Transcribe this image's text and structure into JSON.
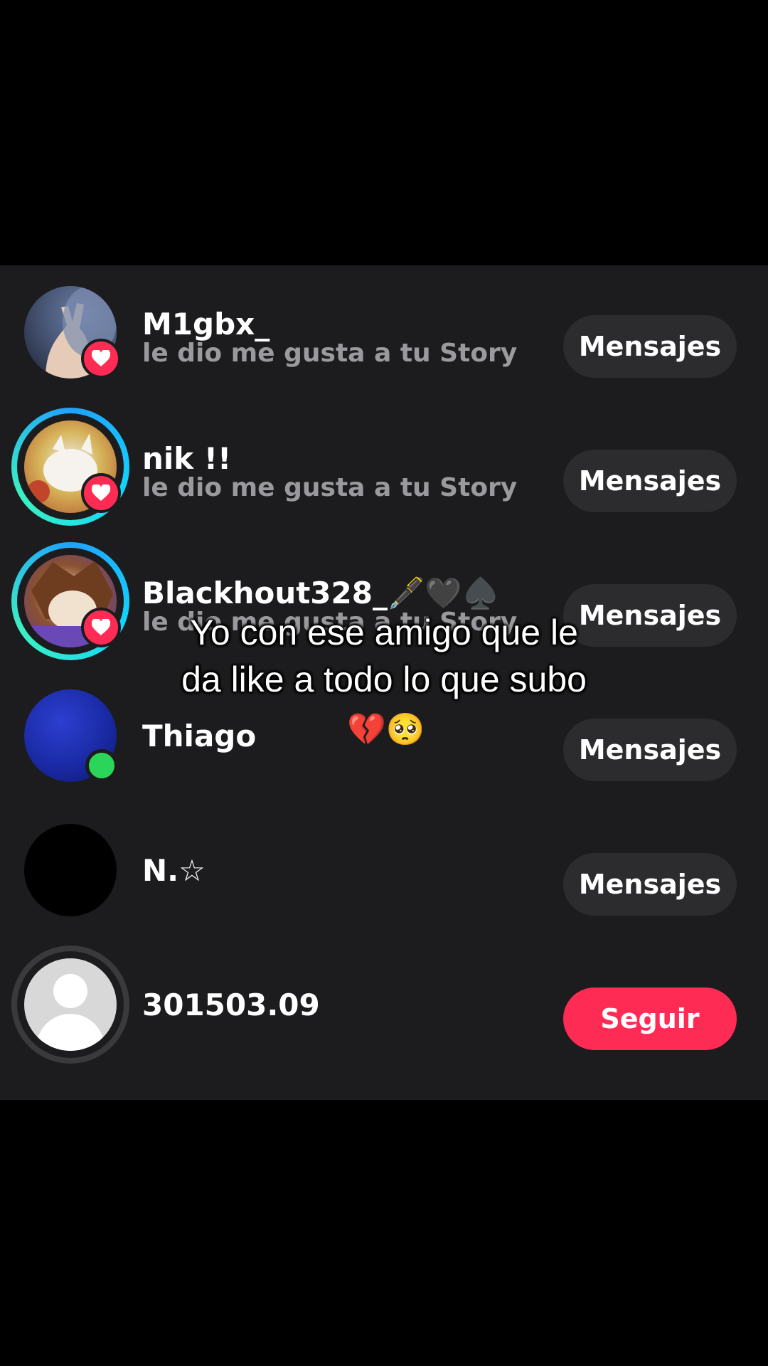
{
  "colors": {
    "panel_bg": "#1c1c1e",
    "button_bg": "#2c2c2e",
    "follow_bg": "#fe2c55",
    "like_badge": "#fe2c55",
    "online": "#2bd55a",
    "subtext": "#9a9a9e"
  },
  "rows": [
    {
      "name": "M1gbx_",
      "subtitle": "le dio me gusta a tu Story",
      "button": "Mensajes",
      "badge": "heart-icon"
    },
    {
      "name": "nik !!",
      "subtitle": "le dio me gusta a tu Story",
      "button": "Mensajes",
      "badge": "heart-icon",
      "ring": "story"
    },
    {
      "name": "Blackhout328_🖋️🖤♠️",
      "subtitle": "le dio me gusta a tu Story",
      "button": "Mensajes",
      "badge": "heart-icon",
      "ring": "story"
    },
    {
      "name": "Thiago",
      "button": "Mensajes",
      "badge": "online-dot"
    },
    {
      "name": "N.☆",
      "button": "Mensajes"
    },
    {
      "name": "301503.09",
      "button": "Seguir",
      "ring": "gray"
    }
  ],
  "overlay": {
    "line1": "Yo con ese amigo que le",
    "line2": "da like a todo lo que subo",
    "emoji": "💔🥺"
  }
}
